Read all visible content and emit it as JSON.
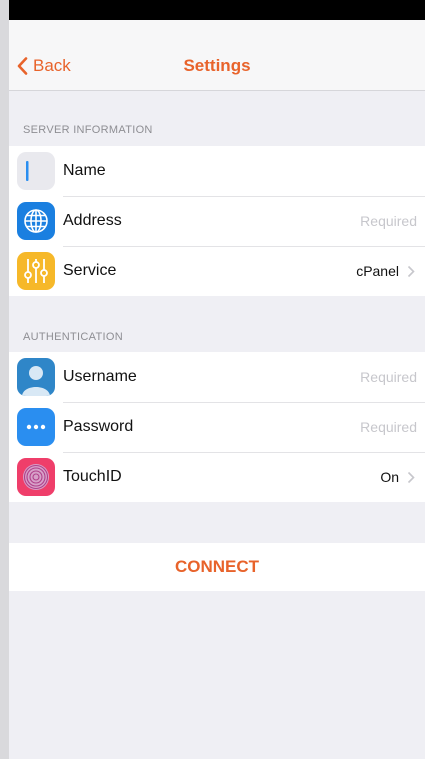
{
  "nav": {
    "back_label": "Back",
    "title": "Settings"
  },
  "server_section": {
    "header": "SERVER INFORMATION",
    "name": {
      "label": "Name",
      "value": ""
    },
    "address": {
      "label": "Address",
      "placeholder": "Required"
    },
    "service": {
      "label": "Service",
      "value": "cPanel"
    }
  },
  "auth_section": {
    "header": "AUTHENTICATION",
    "username": {
      "label": "Username",
      "placeholder": "Required"
    },
    "password": {
      "label": "Password",
      "placeholder": "Required"
    },
    "touchid": {
      "label": "TouchID",
      "value": "On"
    }
  },
  "connect_label": "CONNECT",
  "icons": [
    "back-chevron-icon",
    "text-cursor-icon",
    "globe-icon",
    "sliders-icon",
    "user-icon",
    "ellipsis-icon",
    "fingerprint-icon",
    "chevron-right-icon"
  ],
  "colors": {
    "accent": "#e8632b",
    "globe": "#1a7fe0",
    "sliders": "#f6b829",
    "user": "#2f86c8",
    "password": "#2a8ef0",
    "touchid": "#ef3e6a"
  }
}
